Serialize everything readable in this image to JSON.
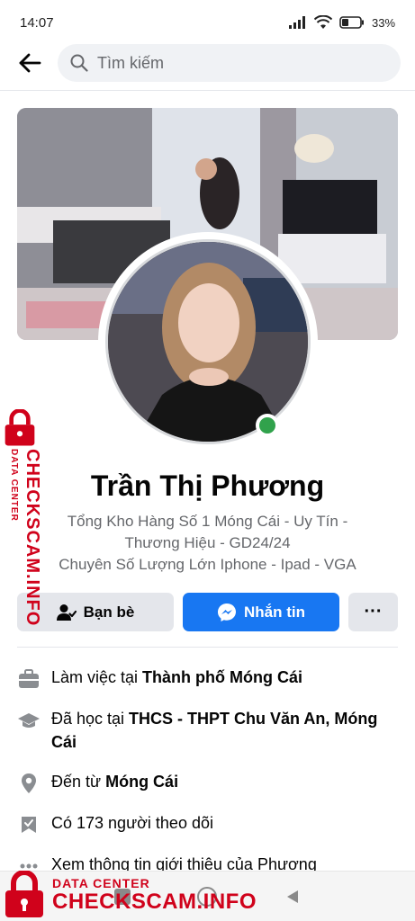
{
  "status_bar": {
    "time": "14:07",
    "battery": "33"
  },
  "search": {
    "placeholder": "Tìm kiếm"
  },
  "profile": {
    "name": "Trần Thị Phương",
    "bio_lines": [
      "Tổng Kho Hàng Số 1 Móng Cái - Uy Tín -",
      "Thương Hiệu  - GD24/24",
      "Chuyên Số Lượng Lớn Iphone - Ipad - VGA"
    ],
    "online": true
  },
  "actions": {
    "friends_label": "Bạn bè",
    "message_label": "Nhắn tin",
    "more_label": "···"
  },
  "info": {
    "work": {
      "prefix": "Làm việc tại ",
      "place": "Thành phố Móng Cái"
    },
    "study": {
      "prefix": "Đã học tại ",
      "place": "THCS - THPT Chu Văn An, Móng Cái"
    },
    "from": {
      "prefix": "Đến từ ",
      "place": "Móng Cái"
    },
    "followers": {
      "text": "Có 173 người theo dõi"
    },
    "about_link": {
      "text": "Xem thông tin giới thiệu của Phương"
    }
  },
  "watermark": {
    "small": "DATA CENTER",
    "big": "CHECKSCAM.INFO"
  },
  "colors": {
    "accent": "#1877f2",
    "online": "#31a24c",
    "watermark": "#d0021b"
  },
  "icons": [
    "back-arrow-icon",
    "search-icon",
    "wifi-icon",
    "signal-icon",
    "battery-icon",
    "add-friend-icon",
    "messenger-icon",
    "briefcase-icon",
    "graduation-cap-icon",
    "location-pin-icon",
    "followers-icon",
    "lock-icon"
  ]
}
